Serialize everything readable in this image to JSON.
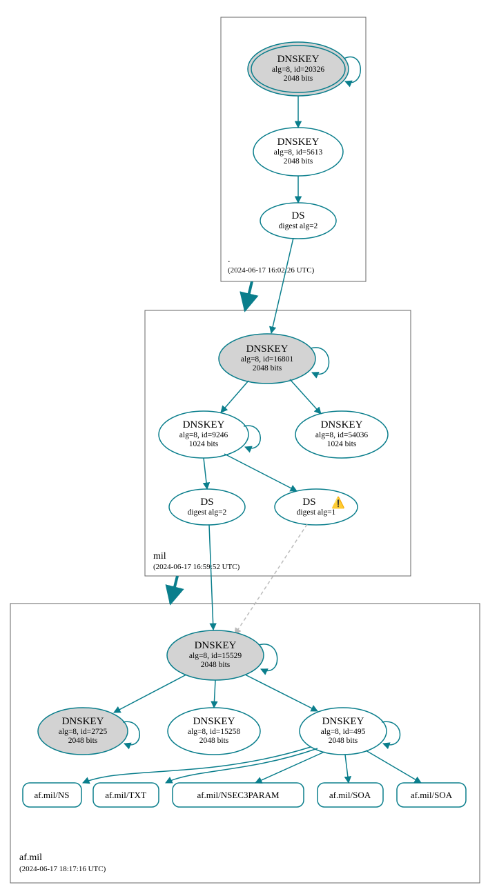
{
  "zones": {
    "root": {
      "label": ".",
      "timestamp": "(2024-06-17 16:02:26 UTC)"
    },
    "mil": {
      "label": "mil",
      "timestamp": "(2024-06-17 16:59:52 UTC)"
    },
    "afmil": {
      "label": "af.mil",
      "timestamp": "(2024-06-17 18:17:16 UTC)"
    }
  },
  "nodes": {
    "root_ksk": {
      "title": "DNSKEY",
      "line2": "alg=8, id=20326",
      "line3": "2048 bits"
    },
    "root_zsk": {
      "title": "DNSKEY",
      "line2": "alg=8, id=5613",
      "line3": "2048 bits"
    },
    "root_ds": {
      "title": "DS",
      "line2": "digest alg=2"
    },
    "mil_ksk": {
      "title": "DNSKEY",
      "line2": "alg=8, id=16801",
      "line3": "2048 bits"
    },
    "mil_zsk1": {
      "title": "DNSKEY",
      "line2": "alg=8, id=9246",
      "line3": "1024 bits"
    },
    "mil_zsk2": {
      "title": "DNSKEY",
      "line2": "alg=8, id=54036",
      "line3": "1024 bits"
    },
    "mil_ds1": {
      "title": "DS",
      "line2": "digest alg=2"
    },
    "mil_ds2": {
      "title": "DS",
      "line2": "digest alg=1",
      "warn": "⚠️"
    },
    "af_ksk": {
      "title": "DNSKEY",
      "line2": "alg=8, id=15529",
      "line3": "2048 bits"
    },
    "af_k2": {
      "title": "DNSKEY",
      "line2": "alg=8, id=2725",
      "line3": "2048 bits"
    },
    "af_k3": {
      "title": "DNSKEY",
      "line2": "alg=8, id=15258",
      "line3": "2048 bits"
    },
    "af_k4": {
      "title": "DNSKEY",
      "line2": "alg=8, id=495",
      "line3": "2048 bits"
    }
  },
  "leaves": {
    "ns": "af.mil/NS",
    "txt": "af.mil/TXT",
    "nsec": "af.mil/NSEC3PARAM",
    "soa1": "af.mil/SOA",
    "soa2": "af.mil/SOA"
  }
}
